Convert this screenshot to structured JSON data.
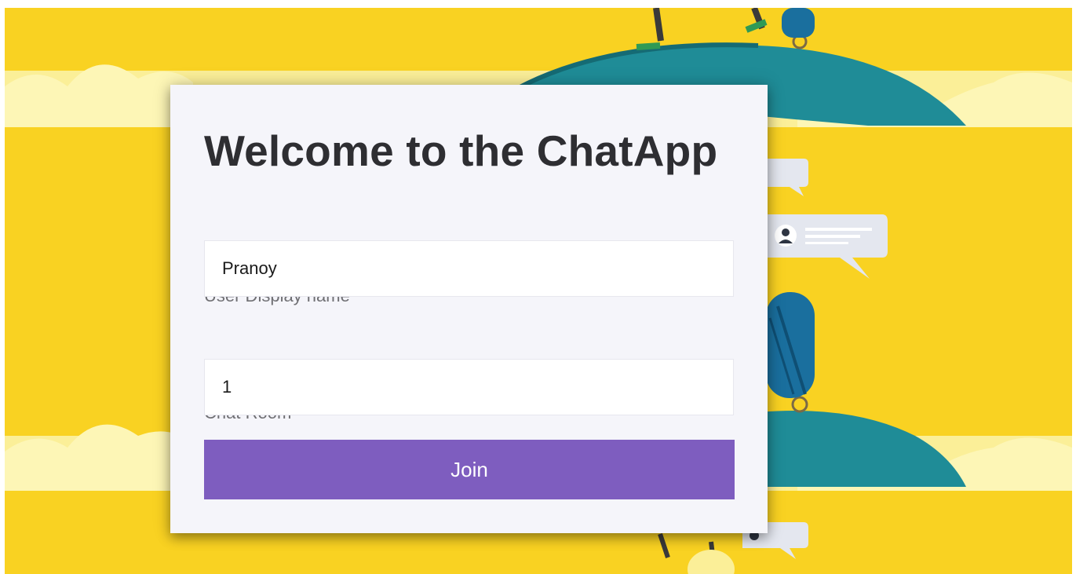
{
  "page": {
    "title": "Welcome to the ChatApp"
  },
  "form": {
    "name_label": "User Display name",
    "name_value": "Pranoy",
    "room_label": "Chat Room",
    "room_value": "1",
    "join_label": "Join"
  },
  "colors": {
    "background": "#f9d222",
    "card": "#f5f5fa",
    "accent": "#7e5dbf",
    "umbrella": "#1f8c97"
  }
}
